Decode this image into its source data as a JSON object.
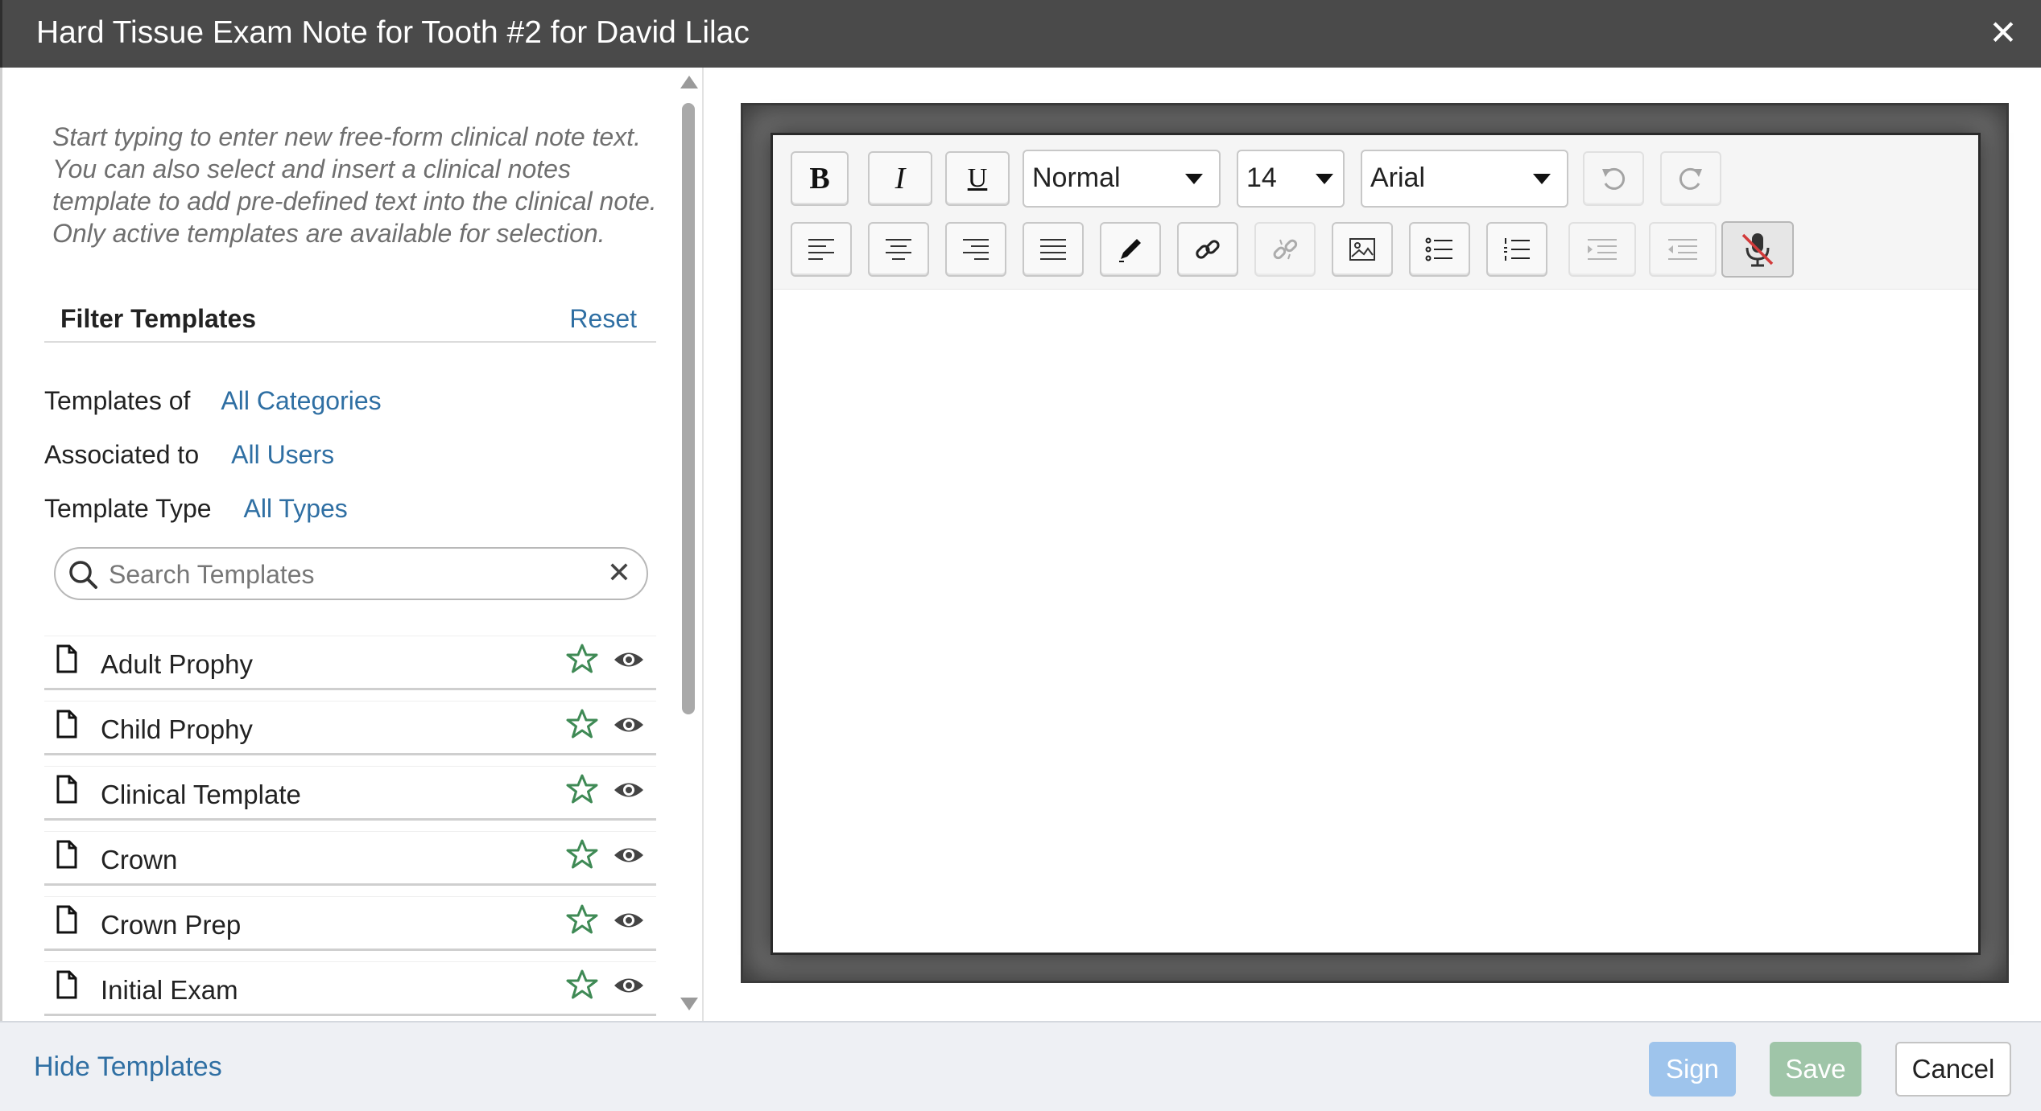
{
  "window": {
    "title": "Hard Tissue Exam Note for Tooth #2 for David Lilac",
    "close_icon": "close-icon"
  },
  "templates_panel": {
    "hint": "Start typing to enter new free-form clinical note text. You can also select and insert a clinical notes template to add pre-defined text into the clinical note. Only active templates are available for selection.",
    "filter_title": "Filter Templates",
    "reset_label": "Reset",
    "filters": [
      {
        "label": "Templates of",
        "value": "All Categories"
      },
      {
        "label": "Associated to",
        "value": "All Users"
      },
      {
        "label": "Template Type",
        "value": "All Types"
      }
    ],
    "search": {
      "placeholder": "Search Templates",
      "value": ""
    },
    "items": [
      {
        "label": "Adult Prophy"
      },
      {
        "label": "Child Prophy"
      },
      {
        "label": "Clinical Template"
      },
      {
        "label": "Crown"
      },
      {
        "label": "Crown Prep"
      },
      {
        "label": "Initial Exam"
      }
    ]
  },
  "editor": {
    "toolbar": {
      "bold": "B",
      "italic": "I",
      "underline": "U",
      "format": "Normal",
      "font_size": "14",
      "font_family": "Arial"
    },
    "content": ""
  },
  "footer": {
    "hide_templates": "Hide Templates",
    "sign": "Sign",
    "save": "Save",
    "cancel": "Cancel"
  },
  "colors": {
    "titlebar": "#4a4a4a",
    "link": "#2f6fa3",
    "star": "#3f8a55",
    "sign_disabled": "#9ec4ec",
    "save_disabled": "#9fc5a8"
  }
}
